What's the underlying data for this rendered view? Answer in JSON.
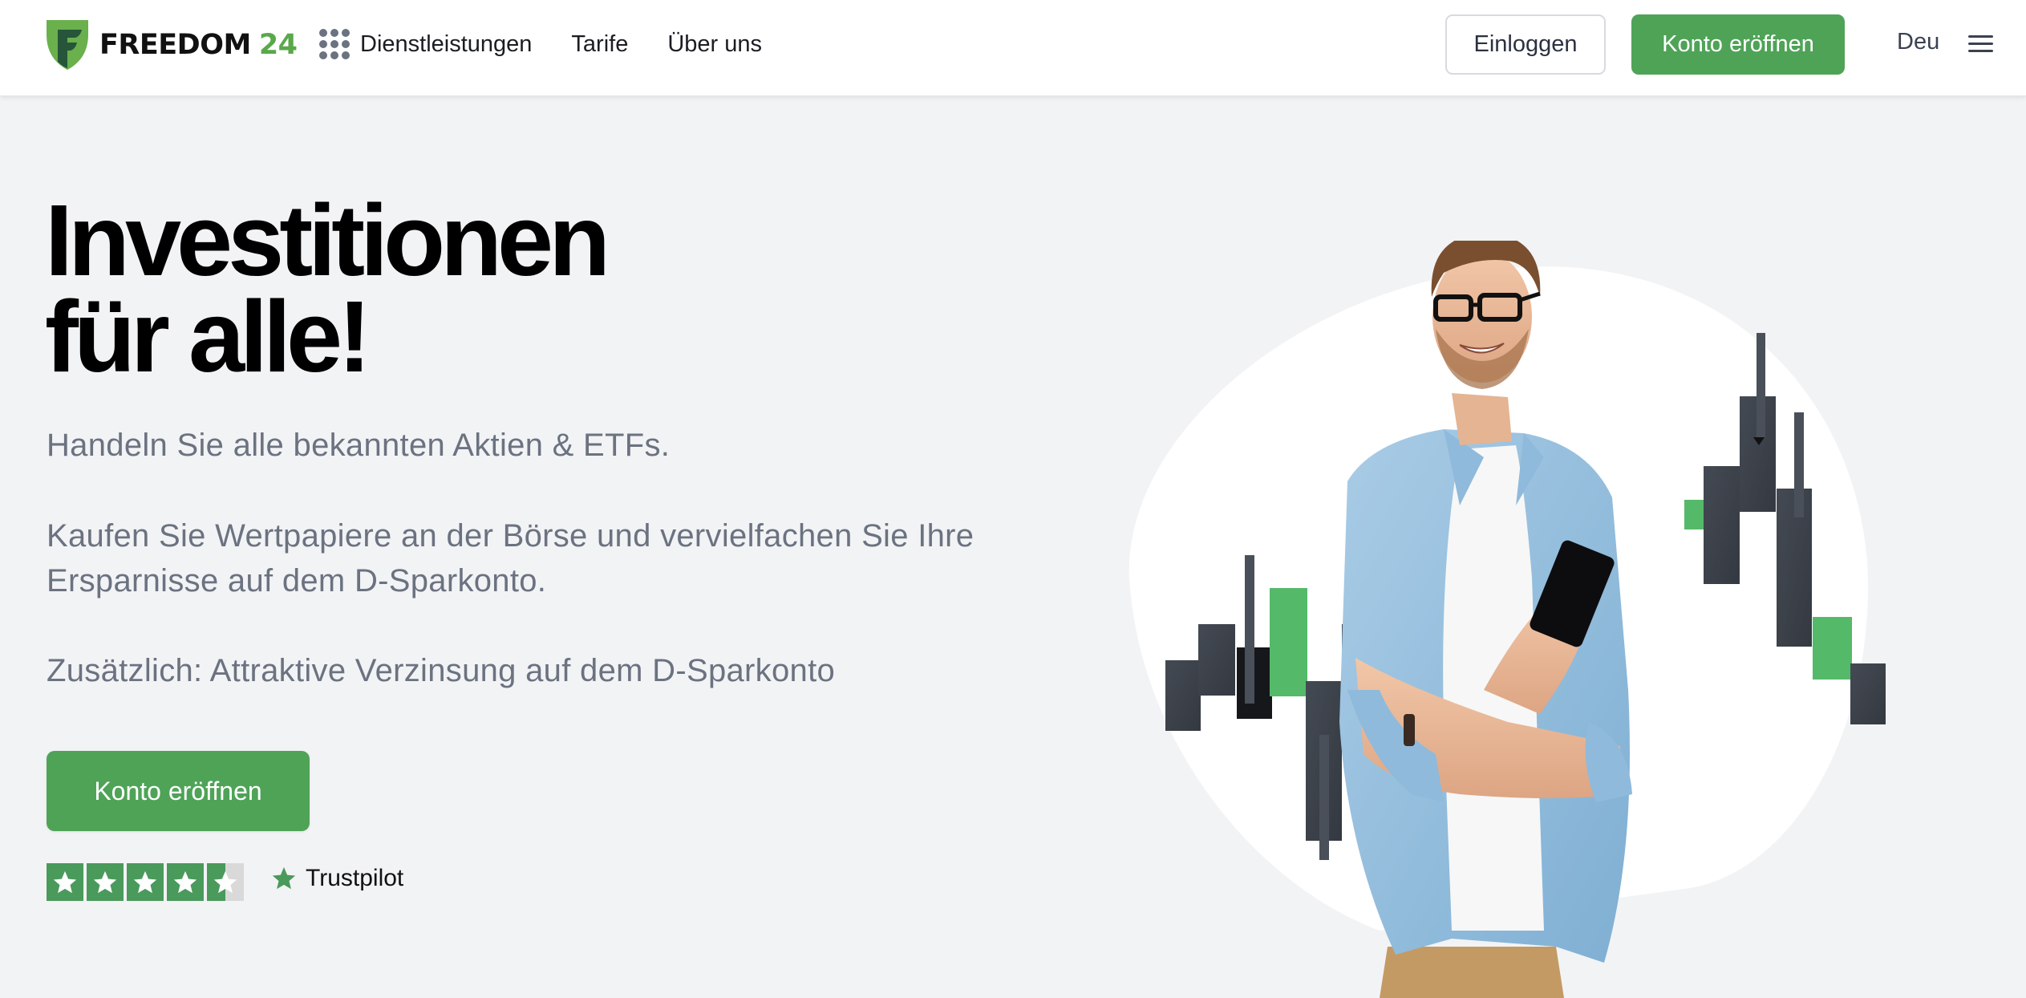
{
  "header": {
    "logo": {
      "brand": "FREEDOM",
      "number": "24",
      "icon": "freedom24-shield-logo-icon"
    },
    "nav": [
      {
        "label": "Dienstleistungen",
        "icon": "grid-dots-icon"
      },
      {
        "label": "Tarife"
      },
      {
        "label": "Über uns"
      }
    ],
    "login_label": "Einloggen",
    "open_account_label": "Konto eröffnen",
    "language": "Deu",
    "menu_icon": "hamburger-menu-icon"
  },
  "hero": {
    "title_line1": "Investitionen",
    "title_line2": "für alle!",
    "subtitle": "Handeln Sie alle bekannten Aktien & ETFs.",
    "paragraph": "Kaufen Sie Wertpapiere an der Börse und vervielfachen Sie Ihre Ersparnisse auf dem D-Sparkonto.",
    "extra": "Zusätzlich: Attraktive Verzinsung auf dem D-Sparkonto",
    "cta_label": "Konto eröffnen",
    "rating": {
      "stars_total": 5,
      "stars_value": 4.5,
      "provider": "Trustpilot",
      "provider_icon": "trustpilot-star-icon"
    }
  },
  "illustration": {
    "description": "Smiling man with glasses in denim shirt holding a smartphone, in front of candlestick chart bars on a white blob",
    "colors": {
      "green_candle": "#55b96a",
      "dark_candle": "#3d434c",
      "blob": "#ffffff"
    }
  },
  "colors": {
    "brand_green": "#4fa357",
    "logo_green": "#5aa84a",
    "logo_dark_green": "#27553a",
    "text_muted": "#6b7280",
    "background": "#f2f3f5"
  }
}
